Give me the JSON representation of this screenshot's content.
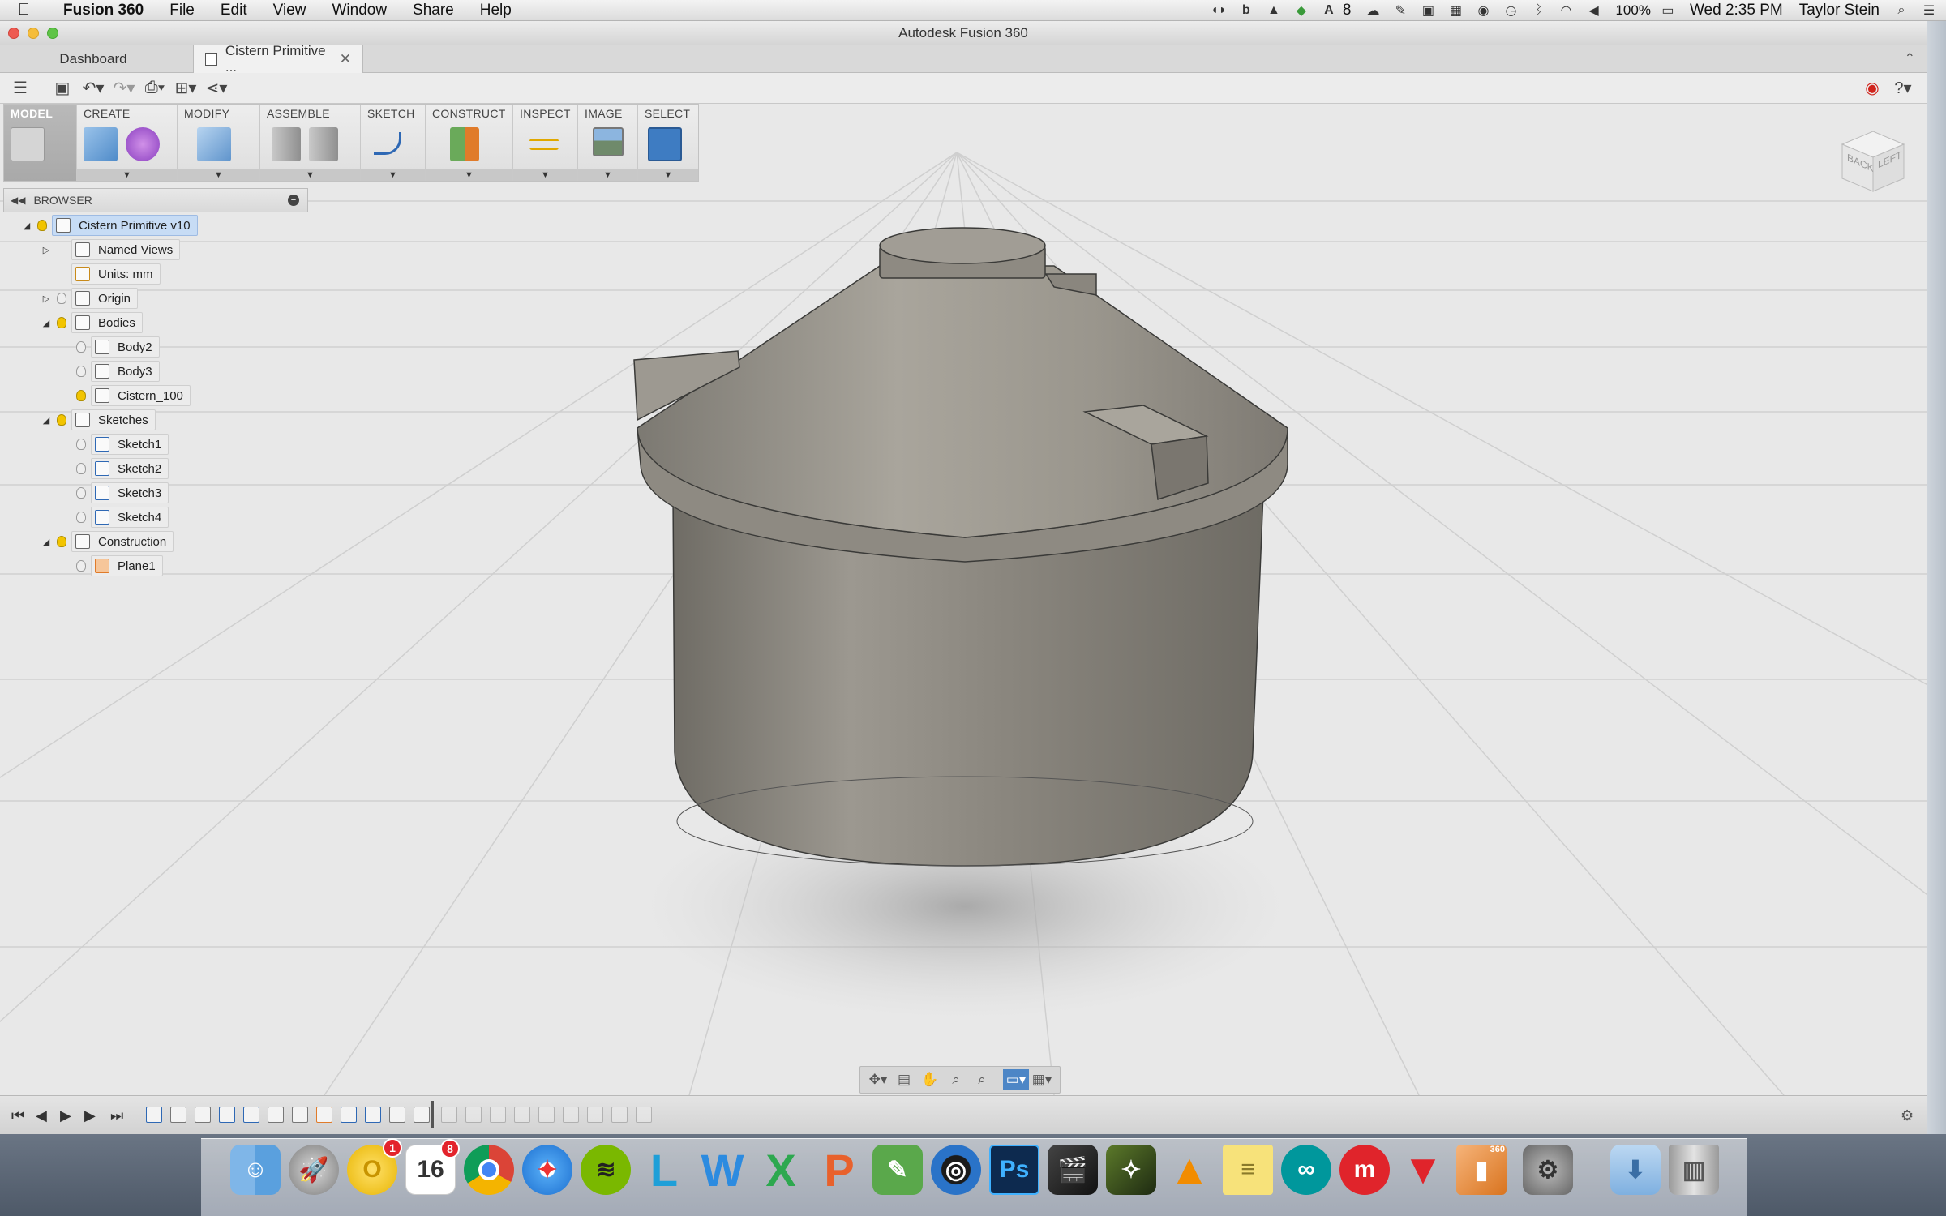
{
  "menubar": {
    "app_name": "Fusion 360",
    "items": [
      "File",
      "Edit",
      "View",
      "Window",
      "Share",
      "Help"
    ],
    "badge_count": "8",
    "battery": "100%",
    "clock": "Wed 2:35 PM",
    "user": "Taylor Stein"
  },
  "window": {
    "title": "Autodesk Fusion 360"
  },
  "tabs": [
    {
      "label": "Dashboard"
    },
    {
      "label": "Cistern Primitive ...",
      "close": "✕"
    }
  ],
  "ribbon": {
    "workspace": "MODEL",
    "groups": [
      "CREATE",
      "MODIFY",
      "ASSEMBLE",
      "SKETCH",
      "CONSTRUCT",
      "INSPECT",
      "IMAGE",
      "SELECT"
    ]
  },
  "browser": {
    "title": "BROWSER",
    "root": "Cistern Primitive v10",
    "items": {
      "named_views": "Named Views",
      "units": "Units: mm",
      "origin": "Origin",
      "bodies": "Bodies",
      "body2": "Body2",
      "body3": "Body3",
      "cistern": "Cistern_100",
      "sketches": "Sketches",
      "sketch1": "Sketch1",
      "sketch2": "Sketch2",
      "sketch3": "Sketch3",
      "sketch4": "Sketch4",
      "construction": "Construction",
      "plane1": "Plane1"
    }
  },
  "viewcube": {
    "back": "BACK",
    "left": "LEFT"
  },
  "dock": {
    "calendar_day": "16",
    "calendar_badge": "8",
    "opera_badge": "1",
    "ps_label": "Ps",
    "fusion_badge": "360"
  },
  "colors": {
    "viewport_bg": "#e8e8e8",
    "selected_node": "#c7dcf5",
    "tank_body": "#8a877f",
    "bulb": "#f2c400"
  }
}
